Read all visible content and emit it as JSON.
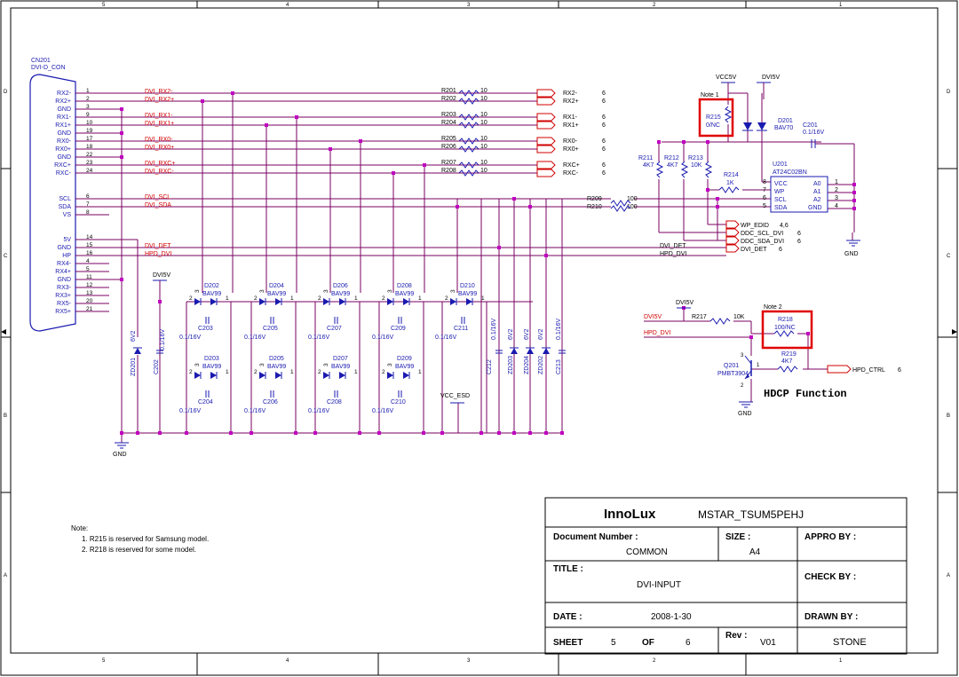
{
  "frame": {
    "columns": [
      "5",
      "4",
      "3",
      "2",
      "1"
    ],
    "rows": [
      "D",
      "C",
      "B",
      "A"
    ]
  },
  "connector": {
    "ref": "CN201",
    "part": "DVI-D_CON",
    "pins": [
      {
        "name": "RX2-",
        "num": "1"
      },
      {
        "name": "RX2+",
        "num": "2"
      },
      {
        "name": "GND",
        "num": "3"
      },
      {
        "name": "RX1-",
        "num": "9"
      },
      {
        "name": "RX1+",
        "num": "10"
      },
      {
        "name": "GND",
        "num": "19"
      },
      {
        "name": "RX0-",
        "num": "17"
      },
      {
        "name": "RX0+",
        "num": "18"
      },
      {
        "name": "GND",
        "num": "22"
      },
      {
        "name": "RXC+",
        "num": "23"
      },
      {
        "name": "RXC-",
        "num": "24"
      },
      {
        "name": "SCL",
        "num": "6"
      },
      {
        "name": "SDA",
        "num": "7"
      },
      {
        "name": "VS",
        "num": "8"
      },
      {
        "name": "5V",
        "num": "14"
      },
      {
        "name": "GND",
        "num": "15"
      },
      {
        "name": "HP",
        "num": "16"
      },
      {
        "name": "RX4-",
        "num": "4"
      },
      {
        "name": "RX4+",
        "num": "5"
      },
      {
        "name": "GND",
        "num": "11"
      },
      {
        "name": "RX3-",
        "num": "12"
      },
      {
        "name": "RX3+",
        "num": "13"
      },
      {
        "name": "RX5-",
        "num": "20"
      },
      {
        "name": "RX5+",
        "num": "21"
      }
    ]
  },
  "nets": {
    "dvi": [
      "DVI_RX2-",
      "DVI_RX2+",
      "DVI_RX1-",
      "DVI_RX1+",
      "DVI_RX0-",
      "DVI_RX0+",
      "DVI_RXC+",
      "DVI_RXC-",
      "DVI_SCL",
      "DVI_SDA",
      "DVI_DET",
      "HPD_DVI"
    ],
    "outputs": [
      "RX2-",
      "RX2+",
      "RX1-",
      "RX1+",
      "RX0-",
      "RX0+",
      "RXC+",
      "RXC-"
    ],
    "out_page": "6",
    "ddc": [
      "WP_EDID",
      "DDC_SCL_DVI",
      "DDC_SDA_DVI",
      "DVI_DET"
    ],
    "ddc_pages": [
      "4,6",
      "6",
      "6",
      "6"
    ],
    "dvi_det_label": "DVI_DET",
    "hpd_dvi_label": "HPD_DVI"
  },
  "resistors": {
    "series": [
      {
        "ref": "R201",
        "val": "10"
      },
      {
        "ref": "R202",
        "val": "10"
      },
      {
        "ref": "R203",
        "val": "10"
      },
      {
        "ref": "R204",
        "val": "10"
      },
      {
        "ref": "R205",
        "val": "10"
      },
      {
        "ref": "R206",
        "val": "10"
      },
      {
        "ref": "R207",
        "val": "10"
      },
      {
        "ref": "R208",
        "val": "10"
      }
    ],
    "r209": {
      "ref": "R209",
      "val": "100"
    },
    "r210": {
      "ref": "R210",
      "val": "100"
    },
    "r211": {
      "ref": "R211",
      "val": "4K7"
    },
    "r212": {
      "ref": "R212",
      "val": "4K7"
    },
    "r213": {
      "ref": "R213",
      "val": "10K"
    },
    "r214": {
      "ref": "R214",
      "val": "1K"
    },
    "r215": {
      "ref": "R215",
      "val": "0/NC"
    },
    "r217": {
      "ref": "R217",
      "val": "10K"
    },
    "r218": {
      "ref": "R218",
      "val": "100/NC"
    },
    "r219": {
      "ref": "R219",
      "val": "4K7"
    }
  },
  "power": {
    "vcc5v": "VCC5V",
    "dvi5v": "DVI5V",
    "gnd": "GND",
    "vcc_esd": "VCC_ESD"
  },
  "eeprom": {
    "ref": "U201",
    "part": "AT24C02BN",
    "left_pins": [
      {
        "num": "8",
        "name": "VCC"
      },
      {
        "num": "7",
        "name": "WP"
      },
      {
        "num": "6",
        "name": "SCL"
      },
      {
        "num": "5",
        "name": "SDA"
      }
    ],
    "right_pins": [
      {
        "num": "1",
        "name": "A0"
      },
      {
        "num": "2",
        "name": "A1"
      },
      {
        "num": "3",
        "name": "A2"
      },
      {
        "num": "4",
        "name": "GND"
      }
    ]
  },
  "diodes": {
    "d201": {
      "ref": "D201",
      "part": "BAV70"
    },
    "bav_part": "BAV99",
    "top_refs": [
      "D202",
      "D204",
      "D206",
      "D208",
      "D210"
    ],
    "bottom_refs": [
      "D203",
      "D205",
      "D207",
      "D209"
    ],
    "pin_labels": [
      "2",
      "1",
      "3"
    ]
  },
  "caps": {
    "c201": {
      "ref": "C201",
      "val": "0.1/16V"
    },
    "top": [
      {
        "ref": "C203",
        "val": "0.1/16V"
      },
      {
        "ref": "C205",
        "val": "0.1/16V"
      },
      {
        "ref": "C207",
        "val": "0.1/16V"
      },
      {
        "ref": "C209",
        "val": "0.1/16V"
      },
      {
        "ref": "C211",
        "val": "0.1/16V"
      }
    ],
    "bottom": [
      {
        "ref": "C204",
        "val": "0.1/16V"
      },
      {
        "ref": "C206",
        "val": "0.1/16V"
      },
      {
        "ref": "C208",
        "val": "0.1/16V"
      },
      {
        "ref": "C210",
        "val": "0.1/16V"
      }
    ],
    "c202": {
      "ref": "C202",
      "val": "0.1/16V"
    },
    "c212": {
      "ref": "C212",
      "val": "0.1/16V"
    },
    "c213": {
      "ref": "C213",
      "val": "0.1/16V"
    }
  },
  "zeners": [
    {
      "ref": "ZD201",
      "val": "6V2"
    },
    {
      "ref": "ZD203",
      "val": "6V2"
    },
    {
      "ref": "ZD204",
      "val": "6V2"
    },
    {
      "ref": "ZD202",
      "val": "6V2"
    }
  ],
  "transistor": {
    "ref": "Q201",
    "part": "PMBT3904",
    "pins": [
      "3",
      "1",
      "2"
    ]
  },
  "hpd_ctrl": {
    "label": "HPD_CTRL",
    "page": "6"
  },
  "notes_tags": {
    "note1": "Note 1",
    "note2": "Note 2"
  },
  "hdcp_title": "HDCP Function",
  "notes": {
    "title": "Note:",
    "lines": [
      "1. R215 is reserved for Samsung model.",
      "2. R218 is reserved for some model."
    ]
  },
  "title_block": {
    "company": "InnoLux",
    "project": "MSTAR_TSUM5PEHJ",
    "doc_label": "Document Number :",
    "doc_value": "COMMON",
    "size_label": "SIZE :",
    "size_value": "A4",
    "appro_label": "APPRO BY :",
    "title_label": "TITLE :",
    "title_value": "DVI-INPUT",
    "check_label": "CHECK BY :",
    "date_label": "DATE :",
    "date_value": "2008-1-30",
    "drawn_label": "DRAWN BY :",
    "sheet_label": "SHEET",
    "sheet_value": "5",
    "of_label": "OF",
    "of_value": "6",
    "rev_label": "Rev :",
    "rev_value": "V01",
    "drawn_value": "STONE"
  },
  "colors": {
    "wire": "#7a0060",
    "symbol": "#1a1ab0",
    "net_label": "#d00000",
    "frame": "#000000",
    "highlight": "#e00000"
  }
}
